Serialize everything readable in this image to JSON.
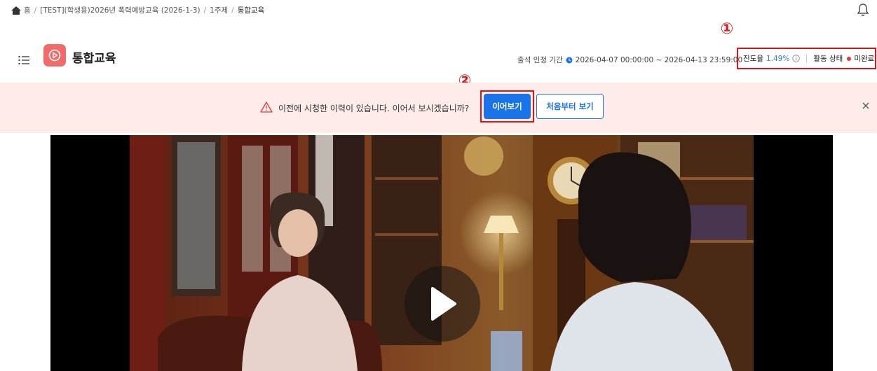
{
  "breadcrumb": {
    "home": "홈",
    "course": "[TEST](학생용)2026년 폭력예방교육 (2026-1-3)",
    "week": "1주제",
    "current": "통합교육"
  },
  "header": {
    "title": "통합교육",
    "attendance_label": "출석 인정 기간",
    "attendance_period": "2026-04-07 00:00:00 ~ 2026-04-13 23:59:00",
    "progress_label": "진도율",
    "progress_value": "1.49%",
    "activity_label": "활동 상태",
    "activity_value": "미완료"
  },
  "markers": {
    "one": "①",
    "two": "②"
  },
  "banner": {
    "message": "이전에 시청한 이력이 있습니다. 이어서 보시겠습니까?",
    "resume_label": "이어보기",
    "restart_label": "처음부터 보기"
  },
  "icons": [
    "home-icon",
    "bell-icon",
    "menu-icon",
    "play-logo-icon",
    "clock-icon",
    "info-icon",
    "warning-icon",
    "close-icon",
    "play-icon"
  ],
  "colors": {
    "accent": "#1a73e8",
    "logo": "#f26b6b",
    "highlight": "#e01515",
    "banner_bg": "#fdecea",
    "status_dot": "#e53935"
  }
}
